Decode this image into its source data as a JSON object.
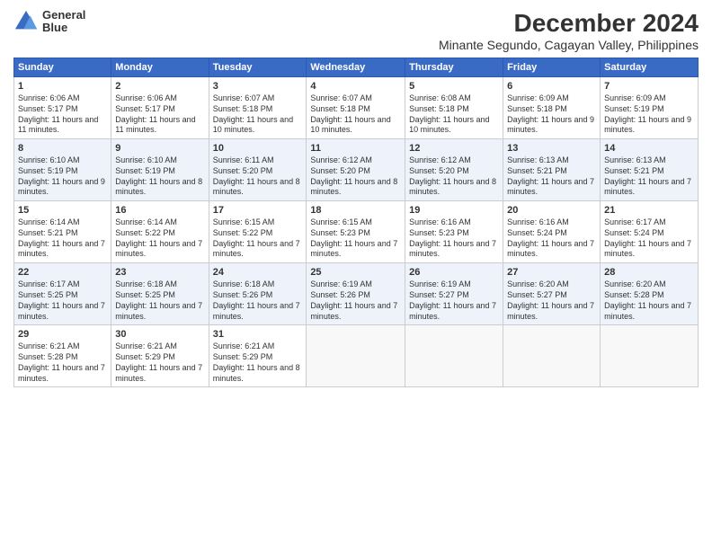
{
  "header": {
    "logo_line1": "General",
    "logo_line2": "Blue",
    "month_title": "December 2024",
    "subtitle": "Minante Segundo, Cagayan Valley, Philippines"
  },
  "days_of_week": [
    "Sunday",
    "Monday",
    "Tuesday",
    "Wednesday",
    "Thursday",
    "Friday",
    "Saturday"
  ],
  "weeks": [
    [
      {
        "day": "1",
        "sunrise": "6:06 AM",
        "sunset": "5:17 PM",
        "daylight": "11 hours and 11 minutes."
      },
      {
        "day": "2",
        "sunrise": "6:06 AM",
        "sunset": "5:17 PM",
        "daylight": "11 hours and 11 minutes."
      },
      {
        "day": "3",
        "sunrise": "6:07 AM",
        "sunset": "5:18 PM",
        "daylight": "11 hours and 10 minutes."
      },
      {
        "day": "4",
        "sunrise": "6:07 AM",
        "sunset": "5:18 PM",
        "daylight": "11 hours and 10 minutes."
      },
      {
        "day": "5",
        "sunrise": "6:08 AM",
        "sunset": "5:18 PM",
        "daylight": "11 hours and 10 minutes."
      },
      {
        "day": "6",
        "sunrise": "6:09 AM",
        "sunset": "5:18 PM",
        "daylight": "11 hours and 9 minutes."
      },
      {
        "day": "7",
        "sunrise": "6:09 AM",
        "sunset": "5:19 PM",
        "daylight": "11 hours and 9 minutes."
      }
    ],
    [
      {
        "day": "8",
        "sunrise": "6:10 AM",
        "sunset": "5:19 PM",
        "daylight": "11 hours and 9 minutes."
      },
      {
        "day": "9",
        "sunrise": "6:10 AM",
        "sunset": "5:19 PM",
        "daylight": "11 hours and 8 minutes."
      },
      {
        "day": "10",
        "sunrise": "6:11 AM",
        "sunset": "5:20 PM",
        "daylight": "11 hours and 8 minutes."
      },
      {
        "day": "11",
        "sunrise": "6:12 AM",
        "sunset": "5:20 PM",
        "daylight": "11 hours and 8 minutes."
      },
      {
        "day": "12",
        "sunrise": "6:12 AM",
        "sunset": "5:20 PM",
        "daylight": "11 hours and 8 minutes."
      },
      {
        "day": "13",
        "sunrise": "6:13 AM",
        "sunset": "5:21 PM",
        "daylight": "11 hours and 7 minutes."
      },
      {
        "day": "14",
        "sunrise": "6:13 AM",
        "sunset": "5:21 PM",
        "daylight": "11 hours and 7 minutes."
      }
    ],
    [
      {
        "day": "15",
        "sunrise": "6:14 AM",
        "sunset": "5:21 PM",
        "daylight": "11 hours and 7 minutes."
      },
      {
        "day": "16",
        "sunrise": "6:14 AM",
        "sunset": "5:22 PM",
        "daylight": "11 hours and 7 minutes."
      },
      {
        "day": "17",
        "sunrise": "6:15 AM",
        "sunset": "5:22 PM",
        "daylight": "11 hours and 7 minutes."
      },
      {
        "day": "18",
        "sunrise": "6:15 AM",
        "sunset": "5:23 PM",
        "daylight": "11 hours and 7 minutes."
      },
      {
        "day": "19",
        "sunrise": "6:16 AM",
        "sunset": "5:23 PM",
        "daylight": "11 hours and 7 minutes."
      },
      {
        "day": "20",
        "sunrise": "6:16 AM",
        "sunset": "5:24 PM",
        "daylight": "11 hours and 7 minutes."
      },
      {
        "day": "21",
        "sunrise": "6:17 AM",
        "sunset": "5:24 PM",
        "daylight": "11 hours and 7 minutes."
      }
    ],
    [
      {
        "day": "22",
        "sunrise": "6:17 AM",
        "sunset": "5:25 PM",
        "daylight": "11 hours and 7 minutes."
      },
      {
        "day": "23",
        "sunrise": "6:18 AM",
        "sunset": "5:25 PM",
        "daylight": "11 hours and 7 minutes."
      },
      {
        "day": "24",
        "sunrise": "6:18 AM",
        "sunset": "5:26 PM",
        "daylight": "11 hours and 7 minutes."
      },
      {
        "day": "25",
        "sunrise": "6:19 AM",
        "sunset": "5:26 PM",
        "daylight": "11 hours and 7 minutes."
      },
      {
        "day": "26",
        "sunrise": "6:19 AM",
        "sunset": "5:27 PM",
        "daylight": "11 hours and 7 minutes."
      },
      {
        "day": "27",
        "sunrise": "6:20 AM",
        "sunset": "5:27 PM",
        "daylight": "11 hours and 7 minutes."
      },
      {
        "day": "28",
        "sunrise": "6:20 AM",
        "sunset": "5:28 PM",
        "daylight": "11 hours and 7 minutes."
      }
    ],
    [
      {
        "day": "29",
        "sunrise": "6:21 AM",
        "sunset": "5:28 PM",
        "daylight": "11 hours and 7 minutes."
      },
      {
        "day": "30",
        "sunrise": "6:21 AM",
        "sunset": "5:29 PM",
        "daylight": "11 hours and 7 minutes."
      },
      {
        "day": "31",
        "sunrise": "6:21 AM",
        "sunset": "5:29 PM",
        "daylight": "11 hours and 8 minutes."
      },
      null,
      null,
      null,
      null
    ]
  ]
}
